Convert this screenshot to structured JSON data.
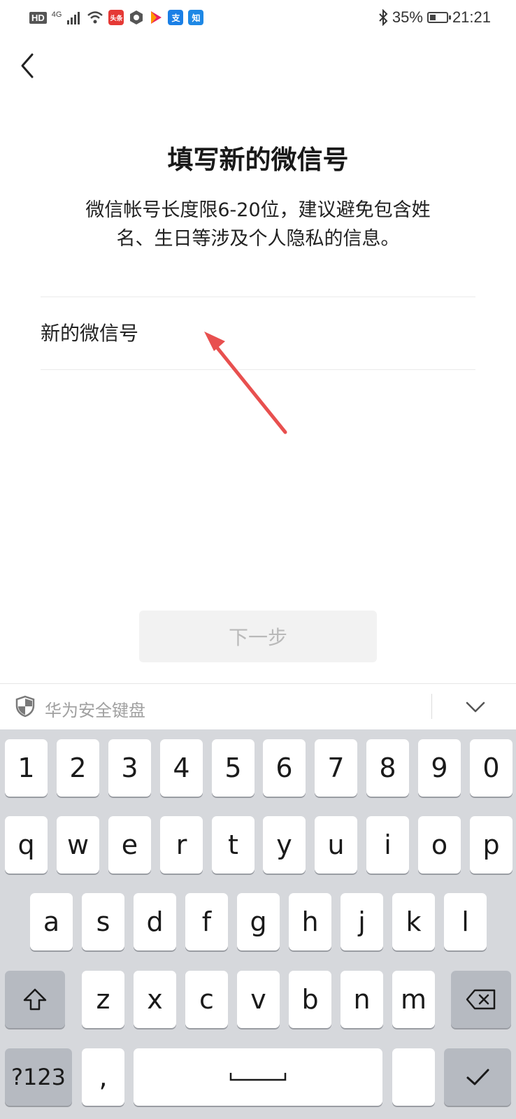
{
  "status_bar": {
    "hd": "HD",
    "network": "4G",
    "app_icons": [
      {
        "icon": "toutiao-icon",
        "label": "头条"
      },
      {
        "icon": "hexagon-app-icon",
        "label": ""
      },
      {
        "icon": "video-play-icon",
        "label": ""
      },
      {
        "icon": "alipay-icon",
        "label": "支"
      },
      {
        "icon": "zhihu-icon",
        "label": "知"
      }
    ],
    "battery_text": "35%",
    "battery_level": 0.35,
    "time": "21:21"
  },
  "page": {
    "title": "填写新的微信号",
    "description_line1": "微信帐号长度限6-20位，建议避免包含姓",
    "description_line2": "名、生日等涉及个人隐私的信息。",
    "input_placeholder": "新的微信号",
    "input_value": "",
    "next_label": "下一步"
  },
  "keyboard": {
    "header_title": "华为安全键盘",
    "row1": [
      "1",
      "2",
      "3",
      "4",
      "5",
      "6",
      "7",
      "8",
      "9",
      "0"
    ],
    "row2": [
      "q",
      "w",
      "e",
      "r",
      "t",
      "y",
      "u",
      "i",
      "o",
      "p"
    ],
    "row3": [
      "a",
      "s",
      "d",
      "f",
      "g",
      "h",
      "j",
      "k",
      "l"
    ],
    "row4": [
      "z",
      "x",
      "c",
      "v",
      "b",
      "n",
      "m"
    ],
    "symbols_label": "?123",
    "comma_label": ","
  },
  "colors": {
    "button_bg": "#f2f2f2",
    "button_text": "#b9b9b9",
    "keyboard_bg": "#d6d8dc",
    "arrow": "#e8504f"
  }
}
